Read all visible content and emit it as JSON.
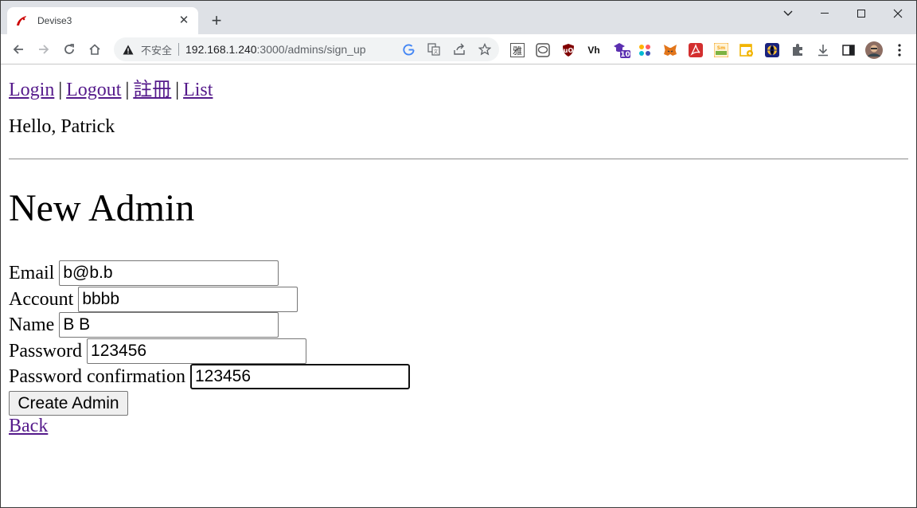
{
  "browser": {
    "tab": {
      "title": "Devise3"
    },
    "omnibox": {
      "insecure_label": "不安全",
      "host": "192.168.1.240",
      "path": ":3000/admins/sign_up"
    },
    "extensions": [
      {
        "name": "yahoo-dictionary",
        "glyph": "雅",
        "color": "#333333"
      },
      {
        "name": "line",
        "glyph": "L",
        "color": "#555555"
      },
      {
        "name": "ublock",
        "glyph": "μ",
        "color": "#c62828"
      },
      {
        "name": "vh",
        "glyph": "Vh",
        "color": "#111111"
      },
      {
        "name": "tutor",
        "glyph": "10",
        "color": "#5b2fb0"
      },
      {
        "name": "dots",
        "glyph": "",
        "color": "#ff5a5f"
      },
      {
        "name": "metamask",
        "glyph": "",
        "color": "#e2761b"
      },
      {
        "name": "acrobat",
        "glyph": "",
        "color": "#d32f2f"
      },
      {
        "name": "smart-fill",
        "glyph": "Sm",
        "color": "#f5a623"
      },
      {
        "name": "calendar",
        "glyph": "",
        "color": "#f2b400"
      },
      {
        "name": "globe",
        "glyph": "",
        "color": "#1a237e"
      }
    ]
  },
  "page": {
    "nav": {
      "login": "Login",
      "logout": "Logout",
      "register": "註冊",
      "list": "List",
      "separator": "|"
    },
    "greeting": "Hello, Patrick",
    "heading": "New Admin",
    "form": {
      "email": {
        "label": "Email",
        "value": "b@b.b"
      },
      "account": {
        "label": "Account",
        "value": "bbbb"
      },
      "name": {
        "label": "Name",
        "value": "B B"
      },
      "password": {
        "label": "Password",
        "value": "123456"
      },
      "password_confirmation": {
        "label": "Password confirmation",
        "value": "123456"
      },
      "submit_label": "Create Admin"
    },
    "back_link": "Back"
  }
}
